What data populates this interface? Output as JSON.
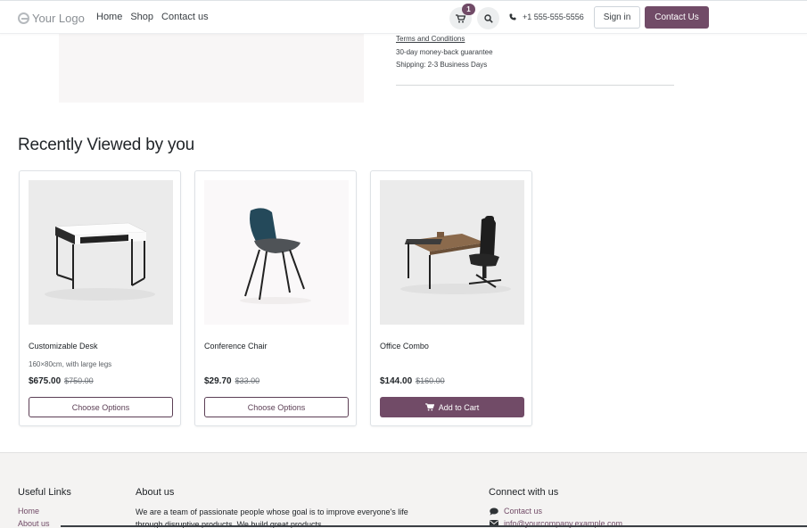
{
  "header": {
    "logo_text": "Your Logo",
    "nav": [
      "Home",
      "Shop",
      "Contact us"
    ],
    "cart_count": "1",
    "phone": "+1 555-555-5556",
    "signin_label": "Sign in",
    "contact_label": "Contact Us",
    "accent_color": "#714b67"
  },
  "product_info": {
    "terms": "Terms and Conditions",
    "guarantee": "30-day money-back guarantee",
    "shipping": "Shipping: 2-3 Business Days"
  },
  "recently_viewed": {
    "title": "Recently Viewed by you",
    "products": [
      {
        "name": "Customizable Desk",
        "description": "160×80cm, with large legs",
        "price": "$675.00",
        "old_price": "$750.00",
        "button": "Choose Options",
        "image_icon": "desk-image"
      },
      {
        "name": "Conference Chair",
        "description": "",
        "price": "$29.70",
        "old_price": "$33.00",
        "button": "Choose Options",
        "image_icon": "chair-image"
      },
      {
        "name": "Office Combo",
        "description": "",
        "price": "$144.00",
        "old_price": "$160.00",
        "button": "Add to Cart",
        "image_icon": "desk-chair-combo-image"
      }
    ]
  },
  "footer": {
    "useful_links_title": "Useful Links",
    "useful_links": [
      "Home",
      "About us"
    ],
    "about_title": "About us",
    "about_text": "We are a team of passionate people whose goal is to improve everyone's life through disruptive products. We build great products",
    "connect_title": "Connect with us",
    "contact_link": "Contact us",
    "email": "info@yourcompany.example.com"
  }
}
